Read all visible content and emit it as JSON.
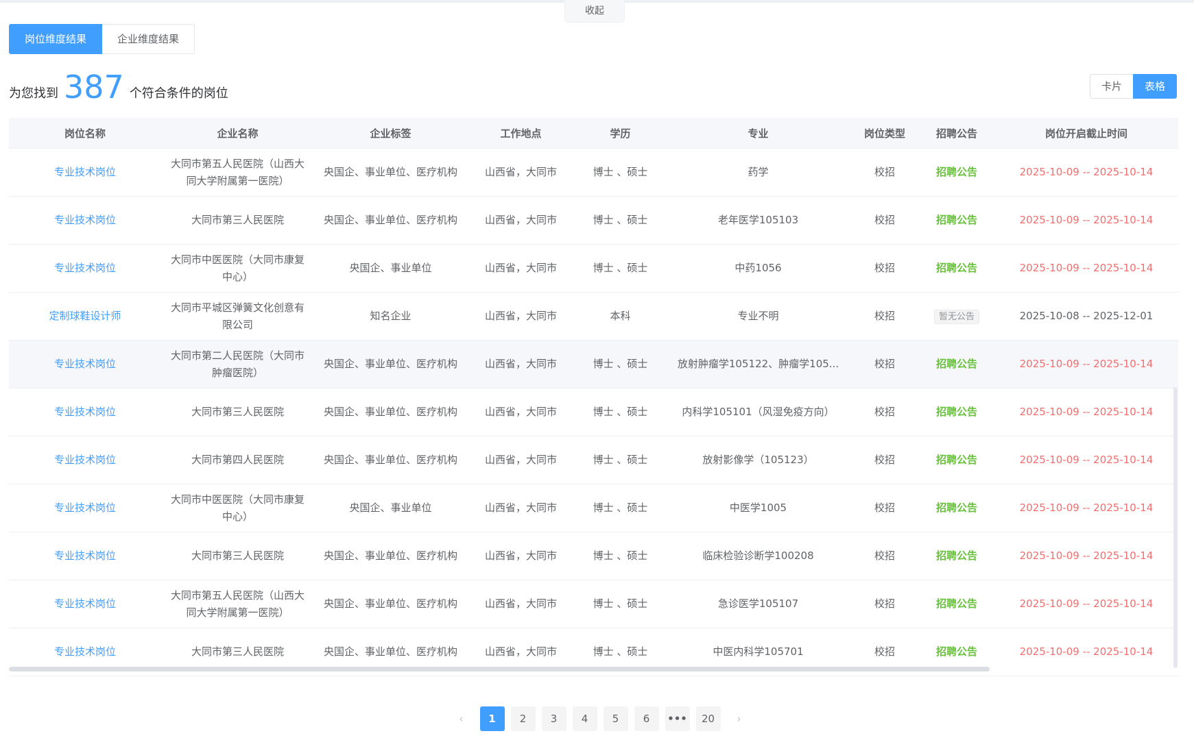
{
  "collapse_label": "收起",
  "tabs": [
    {
      "label": "岗位维度结果",
      "active": true
    },
    {
      "label": "企业维度结果",
      "active": false
    }
  ],
  "summary": {
    "prefix": "为您找到",
    "count": "387",
    "suffix": "个符合条件的岗位"
  },
  "view_toggle": {
    "card": "卡片",
    "table": "表格",
    "selected": "table"
  },
  "columns": [
    "岗位名称",
    "企业名称",
    "企业标签",
    "工作地点",
    "学历",
    "专业",
    "岗位类型",
    "招聘公告",
    "岗位开启截止时间"
  ],
  "rows": [
    {
      "position": "专业技术岗位",
      "company": "大同市第五人民医院（山西大同大学附属第一医院）",
      "tags": "央国企、事业单位、医疗机构",
      "location": "山西省，大同市",
      "education": "博士 、硕士",
      "major": "药学",
      "type": "校招",
      "notice": "招聘公告",
      "period": "2025-10-09 -- 2025-10-14"
    },
    {
      "position": "专业技术岗位",
      "company": "大同市第三人民医院",
      "tags": "央国企、事业单位、医疗机构",
      "location": "山西省，大同市",
      "education": "博士 、硕士",
      "major": "老年医学105103",
      "type": "校招",
      "notice": "招聘公告",
      "period": "2025-10-09 -- 2025-10-14"
    },
    {
      "position": "专业技术岗位",
      "company": "大同市中医医院（大同市康复中心）",
      "tags": "央国企、事业单位",
      "location": "山西省，大同市",
      "education": "博士 、硕士",
      "major": "中药1056",
      "type": "校招",
      "notice": "招聘公告",
      "period": "2025-10-09 -- 2025-10-14"
    },
    {
      "position": "定制球鞋设计师",
      "company": "大同市平城区弹簧文化创意有限公司",
      "tags": "知名企业",
      "location": "山西省，大同市",
      "education": "本科",
      "major": "专业不明",
      "type": "校招",
      "notice": "暂无公告",
      "period": "2025-10-08 -- 2025-12-01"
    },
    {
      "position": "专业技术岗位",
      "company": "大同市第二人民医院（大同市肿瘤医院）",
      "tags": "央国企、事业单位、医疗机构",
      "location": "山西省，大同市",
      "education": "博士 、硕士",
      "major": "放射肿瘤学105122、肿瘤学105...",
      "type": "校招",
      "notice": "招聘公告",
      "period": "2025-10-09 -- 2025-10-14"
    },
    {
      "position": "专业技术岗位",
      "company": "大同市第三人民医院",
      "tags": "央国企、事业单位、医疗机构",
      "location": "山西省，大同市",
      "education": "博士 、硕士",
      "major": "内科学105101（风湿免疫方向）",
      "type": "校招",
      "notice": "招聘公告",
      "period": "2025-10-09 -- 2025-10-14"
    },
    {
      "position": "专业技术岗位",
      "company": "大同市第四人民医院",
      "tags": "央国企、事业单位、医疗机构",
      "location": "山西省，大同市",
      "education": "博士 、硕士",
      "major": "放射影像学（105123）",
      "type": "校招",
      "notice": "招聘公告",
      "period": "2025-10-09 -- 2025-10-14"
    },
    {
      "position": "专业技术岗位",
      "company": "大同市中医医院（大同市康复中心）",
      "tags": "央国企、事业单位",
      "location": "山西省，大同市",
      "education": "博士 、硕士",
      "major": "中医学1005",
      "type": "校招",
      "notice": "招聘公告",
      "period": "2025-10-09 -- 2025-10-14"
    },
    {
      "position": "专业技术岗位",
      "company": "大同市第三人民医院",
      "tags": "央国企、事业单位、医疗机构",
      "location": "山西省，大同市",
      "education": "博士 、硕士",
      "major": "临床检验诊断学100208",
      "type": "校招",
      "notice": "招聘公告",
      "period": "2025-10-09 -- 2025-10-14"
    },
    {
      "position": "专业技术岗位",
      "company": "大同市第五人民医院（山西大同大学附属第一医院）",
      "tags": "央国企、事业单位、医疗机构",
      "location": "山西省，大同市",
      "education": "博士 、硕士",
      "major": "急诊医学105107",
      "type": "校招",
      "notice": "招聘公告",
      "period": "2025-10-09 -- 2025-10-14"
    },
    {
      "position": "专业技术岗位",
      "company": "大同市第三人民医院",
      "tags": "央国企、事业单位、医疗机构",
      "location": "山西省，大同市",
      "education": "博士 、硕士",
      "major": "中医内科学105701",
      "type": "校招",
      "notice": "招聘公告",
      "period": "2025-10-09 -- 2025-10-14"
    }
  ],
  "pagination": {
    "prev": "‹",
    "pages": [
      "1",
      "2",
      "3",
      "4",
      "5",
      "6",
      "•••",
      "20"
    ],
    "current": "1",
    "next": "›"
  },
  "colors": {
    "accent": "#409eff",
    "notice_green": "#67c23a",
    "date_red": "#f56c6c"
  }
}
